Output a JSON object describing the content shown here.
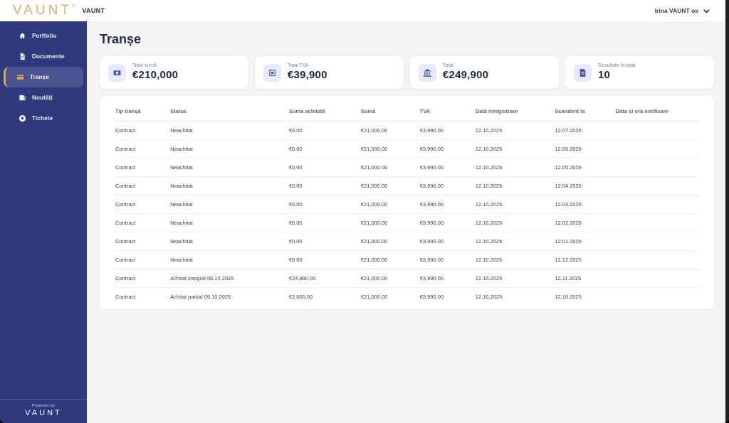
{
  "app": {
    "logo_text": "VAUNT",
    "logo_reg": "®",
    "brand_name": "VAUNT",
    "user_menu_label": "Irina VAUNT os"
  },
  "sidebar": {
    "items": [
      {
        "label": "Portfoliu",
        "icon": "home-icon",
        "active": false
      },
      {
        "label": "Documente",
        "icon": "document-icon",
        "active": false
      },
      {
        "label": "Tranșe",
        "icon": "credit-card-icon",
        "active": true
      },
      {
        "label": "Noutăți",
        "icon": "news-icon",
        "active": false
      },
      {
        "label": "Tichete",
        "icon": "ticket-icon",
        "active": false
      }
    ],
    "footer": {
      "powered_by": "Powered by",
      "logo": "VAUNT"
    }
  },
  "page": {
    "title": "Tranșe"
  },
  "summary_cards": [
    {
      "label": "Total sumă",
      "value": "€210,000",
      "icon": "payments-icon"
    },
    {
      "label": "Total TVA",
      "value": "€39,900",
      "icon": "ballot-icon"
    },
    {
      "label": "Total",
      "value": "€249,900",
      "icon": "bank-icon"
    },
    {
      "label": "Rezultate în total",
      "value": "10",
      "icon": "receipt-icon"
    }
  ],
  "table": {
    "columns": [
      "Tip tranșă",
      "Status",
      "Suma achitată",
      "Sumă",
      "TVA",
      "Dată înregistrare",
      "Scandent la",
      "Data și oră notificare"
    ],
    "rows": [
      {
        "tip": "Contract",
        "status": "Neachitat",
        "suma_achitata": "€0.00",
        "suma": "€21,000.00",
        "tva": "€3,990.00",
        "inregistrare": "12.10.2025",
        "scadent": "12.07.2026",
        "notificare": ""
      },
      {
        "tip": "Contract",
        "status": "Neachitat",
        "suma_achitata": "€0.00",
        "suma": "€21,000.00",
        "tva": "€3,990.00",
        "inregistrare": "12.10.2025",
        "scadent": "12.06.2026",
        "notificare": ""
      },
      {
        "tip": "Contract",
        "status": "Neachitat",
        "suma_achitata": "€0.00",
        "suma": "€21,000.00",
        "tva": "€3,990.00",
        "inregistrare": "12.10.2025",
        "scadent": "12.05.2026",
        "notificare": ""
      },
      {
        "tip": "Contract",
        "status": "Neachitat",
        "suma_achitata": "€0.00",
        "suma": "€21,000.00",
        "tva": "€3,990.00",
        "inregistrare": "12.10.2025",
        "scadent": "12.04.2026",
        "notificare": ""
      },
      {
        "tip": "Contract",
        "status": "Neachitat",
        "suma_achitata": "€0.00",
        "suma": "€21,000.00",
        "tva": "€3,990.00",
        "inregistrare": "12.10.2025",
        "scadent": "12.03.2026",
        "notificare": ""
      },
      {
        "tip": "Contract",
        "status": "Neachitat",
        "suma_achitata": "€0.00",
        "suma": "€21,000.00",
        "tva": "€3,990.00",
        "inregistrare": "12.10.2025",
        "scadent": "12.02.2026",
        "notificare": ""
      },
      {
        "tip": "Contract",
        "status": "Neachitat",
        "suma_achitata": "€0.00",
        "suma": "€21,000.00",
        "tva": "€3,990.00",
        "inregistrare": "12.10.2025",
        "scadent": "12.01.2026",
        "notificare": ""
      },
      {
        "tip": "Contract",
        "status": "Neachitat",
        "suma_achitata": "€0.00",
        "suma": "€21,000.00",
        "tva": "€3,990.00",
        "inregistrare": "12.10.2025",
        "scadent": "12.12.2025",
        "notificare": ""
      },
      {
        "tip": "Contract",
        "status": "Achitat integral 08.10.2025",
        "suma_achitata": "€24,990.00",
        "suma": "€21,000.00",
        "tva": "€3,990.00",
        "inregistrare": "12.10.2025",
        "scadent": "12.11.2025",
        "notificare": ""
      },
      {
        "tip": "Contract",
        "status": "Achitat parțial 09.10.2025",
        "suma_achitata": "€2,000.00",
        "suma": "€21,000.00",
        "tva": "€3,990.00",
        "inregistrare": "12.10.2025",
        "scadent": "12.10.2025",
        "notificare": ""
      }
    ]
  },
  "colors": {
    "sidebar_navy": "#2e3a7d",
    "sidebar_active": "#4b5490",
    "accent_gold": "#d9a845",
    "logo_gold": "#d8b266",
    "icon_blue": "#3f51b5",
    "icon_bg": "#e7eaf8",
    "page_bg": "#f4f4f6",
    "edge_strip": "#1d221f"
  }
}
